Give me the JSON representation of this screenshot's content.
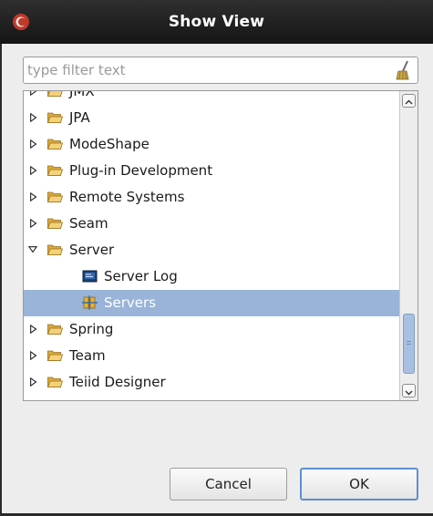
{
  "window": {
    "title": "Show View"
  },
  "filter": {
    "placeholder": "type filter text",
    "value": ""
  },
  "tree": {
    "items": [
      {
        "label": "JMX",
        "kind": "folder",
        "expanded": false,
        "level": 0
      },
      {
        "label": "JPA",
        "kind": "folder",
        "expanded": false,
        "level": 0
      },
      {
        "label": "ModeShape",
        "kind": "folder",
        "expanded": false,
        "level": 0
      },
      {
        "label": "Plug-in Development",
        "kind": "folder",
        "expanded": false,
        "level": 0
      },
      {
        "label": "Remote Systems",
        "kind": "folder",
        "expanded": false,
        "level": 0
      },
      {
        "label": "Seam",
        "kind": "folder",
        "expanded": false,
        "level": 0
      },
      {
        "label": "Server",
        "kind": "folder",
        "expanded": true,
        "level": 0
      },
      {
        "label": "Server Log",
        "kind": "server-log-icon",
        "level": 1
      },
      {
        "label": "Servers",
        "kind": "servers-icon",
        "level": 1,
        "selected": true
      },
      {
        "label": "Spring",
        "kind": "folder",
        "expanded": false,
        "level": 0
      },
      {
        "label": "Team",
        "kind": "folder",
        "expanded": false,
        "level": 0
      },
      {
        "label": "Teiid Designer",
        "kind": "folder",
        "expanded": false,
        "level": 0
      }
    ]
  },
  "buttons": {
    "cancel": "Cancel",
    "ok": "OK"
  },
  "colors": {
    "selection": "#99b4d8",
    "folder": "#e8c35a",
    "titlebar": "#1f1f1f",
    "focus": "#5d8fd1"
  }
}
